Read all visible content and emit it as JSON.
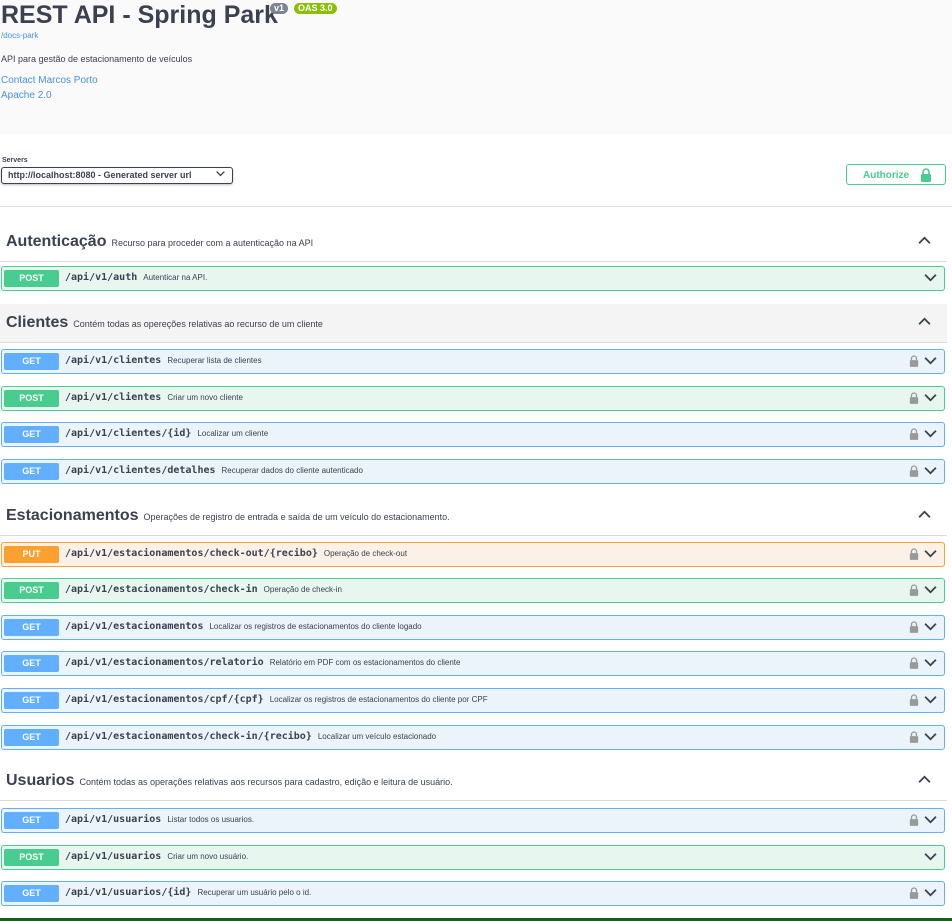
{
  "info": {
    "title": "REST API - Spring Park",
    "version_badge": "v1",
    "oas_badge": "OAS 3.0",
    "docs_link": "/docs-park",
    "description": "API para gestão de estacionamento de veículos",
    "contact": "Contact Marcos Porto",
    "license": "Apache 2.0"
  },
  "servers": {
    "label": "Servers",
    "selected": "http://localhost:8080 - Generated server url"
  },
  "authorize_label": "Authorize",
  "colors": {
    "get": "#61affe",
    "post": "#49cc90",
    "put": "#fca130",
    "link": "#4990e2"
  },
  "tags": [
    {
      "name": "Autenticação",
      "description": "Recurso para proceder com a autenticação na API",
      "operations": [
        {
          "method": "POST",
          "path": "/api/v1/auth",
          "summary": "Autenticar na API.",
          "locked": false
        }
      ]
    },
    {
      "name": "Clientes",
      "description": "Contém todas as opereções relativas ao recurso de um cliente",
      "operations": [
        {
          "method": "GET",
          "path": "/api/v1/clientes",
          "summary": "Recuperar lista de clientes",
          "locked": true
        },
        {
          "method": "POST",
          "path": "/api/v1/clientes",
          "summary": "Criar um novo cliente",
          "locked": true
        },
        {
          "method": "GET",
          "path": "/api/v1/clientes/{id}",
          "summary": "Localizar um cliente",
          "locked": true
        },
        {
          "method": "GET",
          "path": "/api/v1/clientes/detalhes",
          "summary": "Recuperar dados do cliente autenticado",
          "locked": true
        }
      ]
    },
    {
      "name": "Estacionamentos",
      "description": "Operações de registro de entrada e saída de um veículo do estacionamento.",
      "operations": [
        {
          "method": "PUT",
          "path": "/api/v1/estacionamentos/check-out/{recibo}",
          "summary": "Operação de check-out",
          "locked": true
        },
        {
          "method": "POST",
          "path": "/api/v1/estacionamentos/check-in",
          "summary": "Operação de check-in",
          "locked": true
        },
        {
          "method": "GET",
          "path": "/api/v1/estacionamentos",
          "summary": "Localizar os registros de estacionamentos do cliente logado",
          "locked": true
        },
        {
          "method": "GET",
          "path": "/api/v1/estacionamentos/relatorio",
          "summary": "Relatório em PDF com os estacionamentos do cliente",
          "locked": true
        },
        {
          "method": "GET",
          "path": "/api/v1/estacionamentos/cpf/{cpf}",
          "summary": "Localizar os registros de estacionamentos do cliente por CPF",
          "locked": true
        },
        {
          "method": "GET",
          "path": "/api/v1/estacionamentos/check-in/{recibo}",
          "summary": "Localizar um veículo estacionado",
          "locked": true
        }
      ]
    },
    {
      "name": "Usuarios",
      "description": "Contém todas as operações relativas aos recursos para cadastro, edição e leitura de usuário.",
      "operations": [
        {
          "method": "GET",
          "path": "/api/v1/usuarios",
          "summary": "Listar todos os usuarios.",
          "locked": true
        },
        {
          "method": "POST",
          "path": "/api/v1/usuarios",
          "summary": "Criar um novo usuário.",
          "locked": false
        },
        {
          "method": "GET",
          "path": "/api/v1/usuarios/{id}",
          "summary": "Recuperar um usuário pelo o id.",
          "locked": true
        }
      ]
    }
  ]
}
